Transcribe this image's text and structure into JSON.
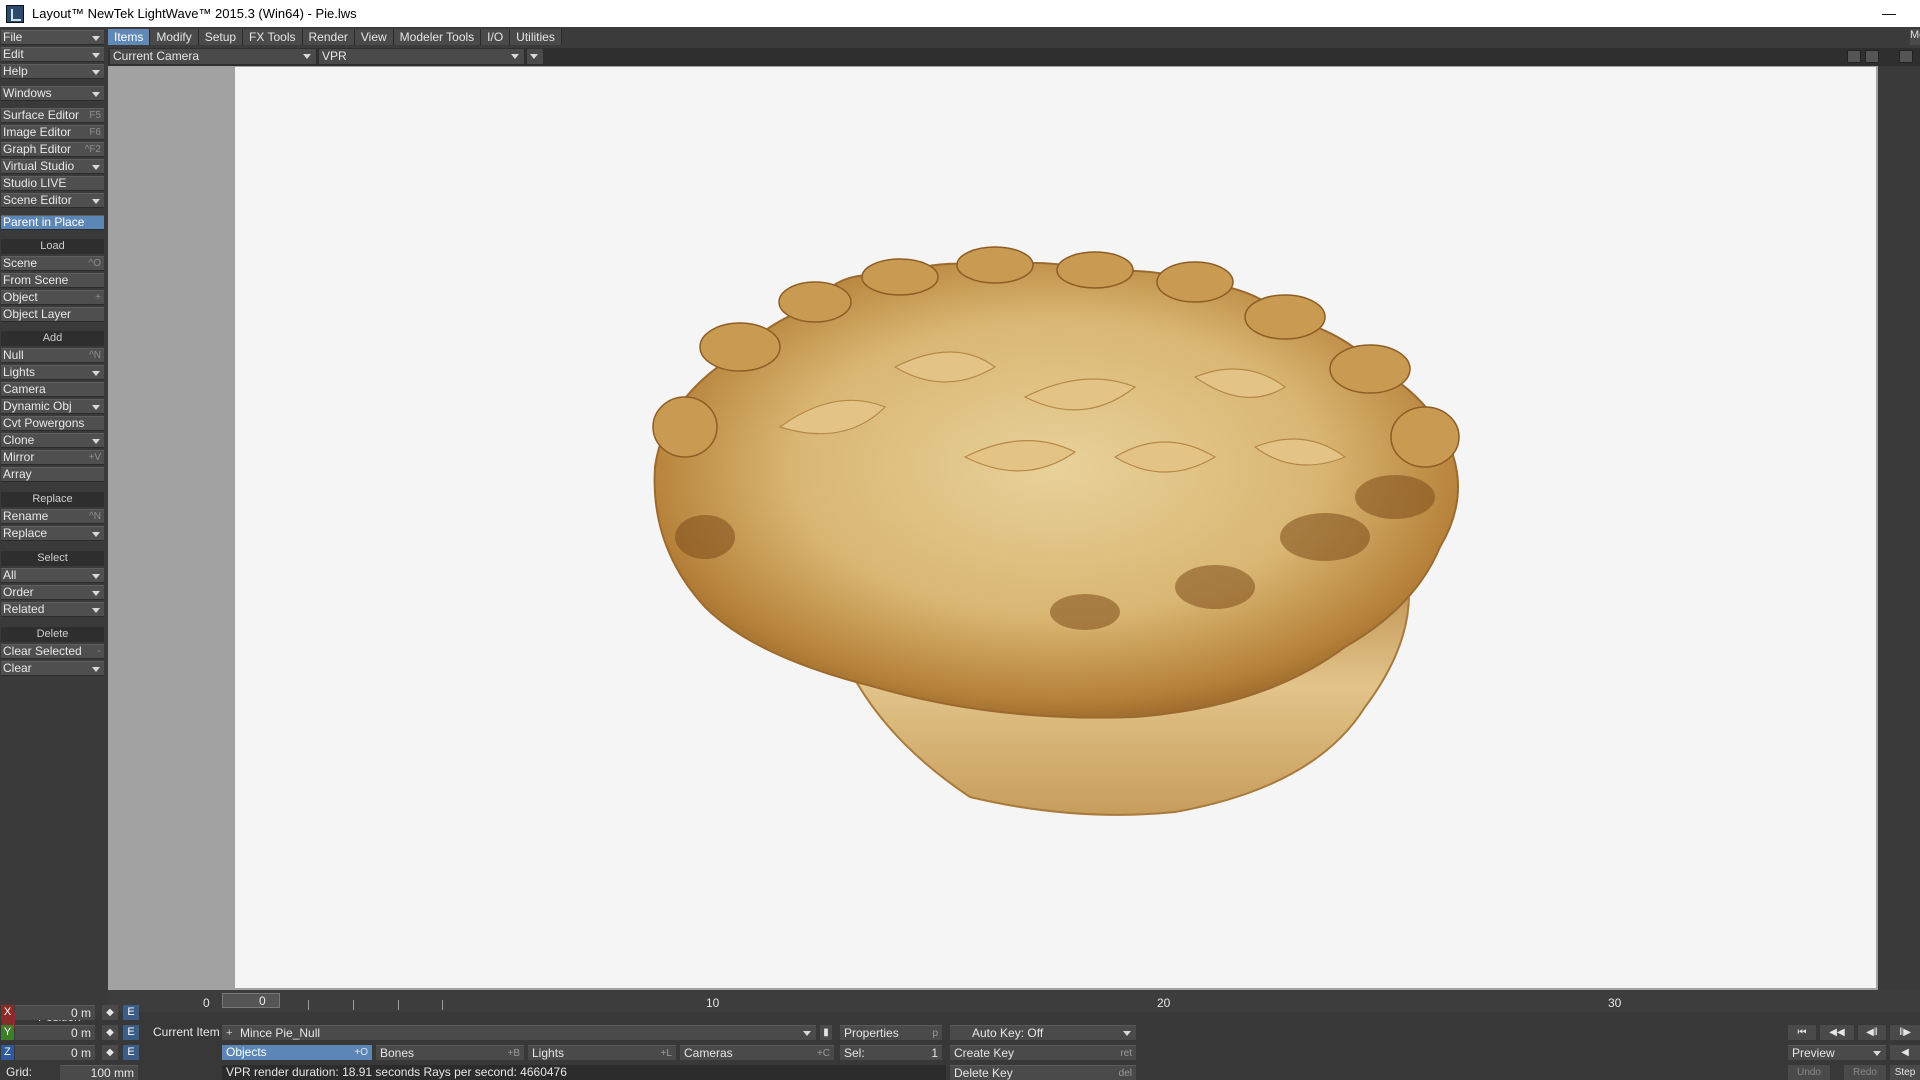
{
  "window": {
    "title": "Layout™ NewTek LightWave™ 2015.3 (Win64) - Pie.lws",
    "minimize_glyph": "—"
  },
  "left_panel": {
    "file": "File",
    "edit": "Edit",
    "help": "Help",
    "windows": "Windows",
    "tools": [
      {
        "label": "Surface Editor",
        "shortcut": "F5"
      },
      {
        "label": "Image Editor",
        "shortcut": "F6"
      },
      {
        "label": "Graph Editor",
        "shortcut": "^F2"
      },
      {
        "label": "Virtual Studio",
        "shortcut": ""
      },
      {
        "label": "Studio LIVE",
        "shortcut": ""
      },
      {
        "label": "Scene Editor",
        "shortcut": ""
      }
    ],
    "parent_in_place": "Parent in Place",
    "load_header": "Load",
    "load": [
      {
        "label": "Scene",
        "shortcut": "^O"
      },
      {
        "label": "From Scene",
        "shortcut": ""
      },
      {
        "label": "Object",
        "shortcut": "+"
      },
      {
        "label": "Object Layer",
        "shortcut": ""
      }
    ],
    "add_header": "Add",
    "add": [
      {
        "label": "Null",
        "shortcut": "^N"
      },
      {
        "label": "Lights",
        "shortcut": ""
      },
      {
        "label": "Camera",
        "shortcut": ""
      },
      {
        "label": "Dynamic Obj",
        "shortcut": ""
      },
      {
        "label": "Cvt Powergons",
        "shortcut": ""
      },
      {
        "label": "Clone",
        "shortcut": ""
      },
      {
        "label": "Mirror",
        "shortcut": "+V"
      },
      {
        "label": "Array",
        "shortcut": ""
      }
    ],
    "replace_header": "Replace",
    "replace": [
      {
        "label": "Rename",
        "shortcut": "^N"
      },
      {
        "label": "Replace",
        "shortcut": ""
      }
    ],
    "select_header": "Select",
    "select": [
      {
        "label": "All",
        "shortcut": ""
      },
      {
        "label": "Order",
        "shortcut": ""
      },
      {
        "label": "Related",
        "shortcut": ""
      }
    ],
    "delete_header": "Delete",
    "delete": [
      {
        "label": "Clear Selected",
        "shortcut": "-"
      },
      {
        "label": "Clear",
        "shortcut": ""
      }
    ]
  },
  "tabs": [
    "Items",
    "Modify",
    "Setup",
    "FX Tools",
    "Render",
    "View",
    "Modeler Tools",
    "I/O",
    "Utilities"
  ],
  "tab_stub": "Mo",
  "viewport_header": {
    "view_select": "Current Camera",
    "render_mode": "VPR"
  },
  "timeline": {
    "start_frame": "0",
    "current_frame_field": "0",
    "labels": [
      "10",
      "20",
      "30"
    ]
  },
  "position_panel": {
    "title": "Position",
    "axes": [
      {
        "axis": "X",
        "value": "0 m",
        "color": "#8a2a2a"
      },
      {
        "axis": "Y",
        "value": "0 m",
        "color": "#3f7d2e"
      },
      {
        "axis": "Z",
        "value": "0 m",
        "color": "#2f5a99"
      }
    ],
    "e_label": "E",
    "grid_label": "Grid:",
    "grid_value": "100 mm"
  },
  "item_controls": {
    "current_item_label": "Current Item",
    "current_item_value": "Mince Pie_Null",
    "properties": "Properties",
    "properties_shortcut": "p",
    "objects": "Objects",
    "objects_shortcut": "+O",
    "bones": "Bones",
    "bones_shortcut": "+B",
    "lights": "Lights",
    "lights_shortcut": "+L",
    "cameras": "Cameras",
    "cameras_shortcut": "+C",
    "sel_label": "Sel:",
    "sel_value": "1",
    "status": "VPR render duration: 18.91 seconds  Rays per second: 4660476"
  },
  "keys": {
    "auto_key": "Auto Key: Off",
    "create_key": "Create Key",
    "create_key_shortcut": "ret",
    "delete_key": "Delete Key",
    "delete_key_shortcut": "del"
  },
  "transport": {
    "preview": "Preview",
    "undo": "Undo",
    "redo": "Redo",
    "step": "Step"
  },
  "colors": {
    "accent": "#5b86b5",
    "viewport_bg": "#f5f5f5"
  }
}
